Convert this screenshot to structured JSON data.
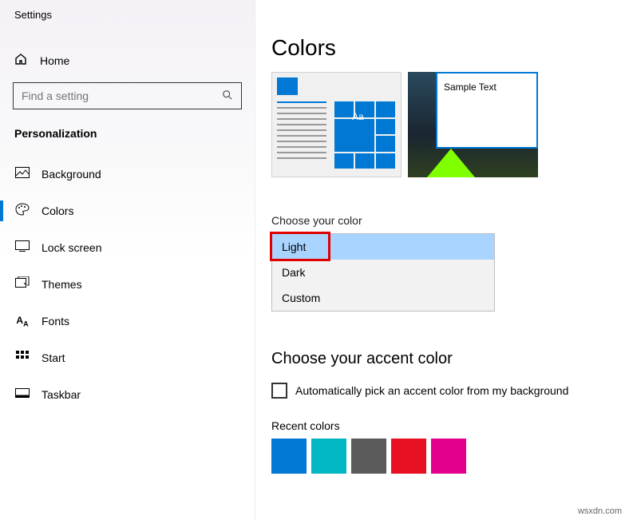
{
  "app_title": "Settings",
  "home_label": "Home",
  "search": {
    "placeholder": "Find a setting"
  },
  "section": "Personalization",
  "nav": [
    {
      "label": "Background"
    },
    {
      "label": "Colors"
    },
    {
      "label": "Lock screen"
    },
    {
      "label": "Themes"
    },
    {
      "label": "Fonts"
    },
    {
      "label": "Start"
    },
    {
      "label": "Taskbar"
    }
  ],
  "page": {
    "title": "Colors",
    "preview": {
      "aa": "Aa",
      "sample_text": "Sample Text"
    },
    "choose_color_label": "Choose your color",
    "color_options": {
      "light": "Light",
      "dark": "Dark",
      "custom": "Custom"
    },
    "accent_title": "Choose your accent color",
    "auto_pick_label": "Automatically pick an accent color from my background",
    "recent_label": "Recent colors",
    "recent_colors": [
      "#0078d4",
      "#00b7c3",
      "#5a5a5a",
      "#e81123",
      "#e3008c"
    ]
  },
  "watermark": "wsxdn.com"
}
